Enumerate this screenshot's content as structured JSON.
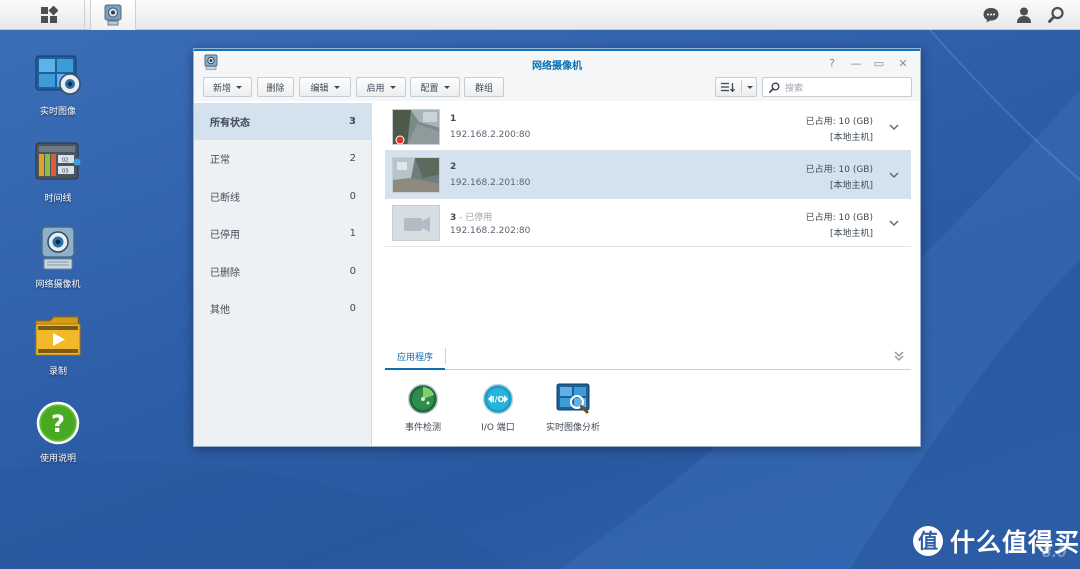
{
  "taskbar": {
    "main_menu_icon": "grid-icon",
    "active_app_icon": "camera-app-icon",
    "right_icons": [
      "chat-icon",
      "user-icon",
      "search-icon"
    ]
  },
  "desktop": {
    "icons": [
      {
        "label": "实时图像",
        "icon": "live-view-icon"
      },
      {
        "label": "时间线",
        "icon": "timeline-icon"
      },
      {
        "label": "网络摄像机",
        "icon": "ip-camera-icon"
      },
      {
        "label": "录制",
        "icon": "recording-folder-icon"
      },
      {
        "label": "使用说明",
        "icon": "help-icon"
      }
    ]
  },
  "window": {
    "title": "网络摄像机",
    "controls": {
      "help": "?",
      "minimize": "—",
      "maximize": "▭",
      "close": "✕"
    },
    "toolbar": {
      "add": "新增",
      "delete": "删除",
      "edit": "编辑",
      "enable": "启用",
      "config": "配置",
      "group": "群组",
      "search_placeholder": "搜索"
    },
    "sidebar": [
      {
        "label": "所有状态",
        "count": "3",
        "active": true
      },
      {
        "label": "正常",
        "count": "2"
      },
      {
        "label": "已断线",
        "count": "0"
      },
      {
        "label": "已停用",
        "count": "1"
      },
      {
        "label": "已删除",
        "count": "0"
      },
      {
        "label": "其他",
        "count": "0"
      }
    ],
    "cameras": [
      {
        "name": "1",
        "status": "",
        "ip": "192.168.2.200:80",
        "used": "已占用:  10 (GB)",
        "host": "[本地主机]"
      },
      {
        "name": "2",
        "status": "",
        "ip": "192.168.2.201:80",
        "used": "已占用:  10 (GB)",
        "host": "[本地主机]"
      },
      {
        "name": "3",
        "status": " - 已停用",
        "ip": "192.168.2.202:80",
        "used": "已占用:  10 (GB)",
        "host": "[本地主机]"
      }
    ],
    "apps_tab": "应用程序",
    "apps": [
      {
        "label": "事件检测",
        "icon": "event-detection-icon"
      },
      {
        "label": "I/O 端口",
        "icon": "io-port-icon"
      },
      {
        "label": "实时图像分析",
        "icon": "live-analytics-icon"
      }
    ]
  },
  "watermark": {
    "text": "什么值得买",
    "version": "8.0"
  },
  "colors": {
    "accent": "#0b6fb5",
    "desktop": "#2e5ea8",
    "selected_row": "#d3e2ee"
  }
}
